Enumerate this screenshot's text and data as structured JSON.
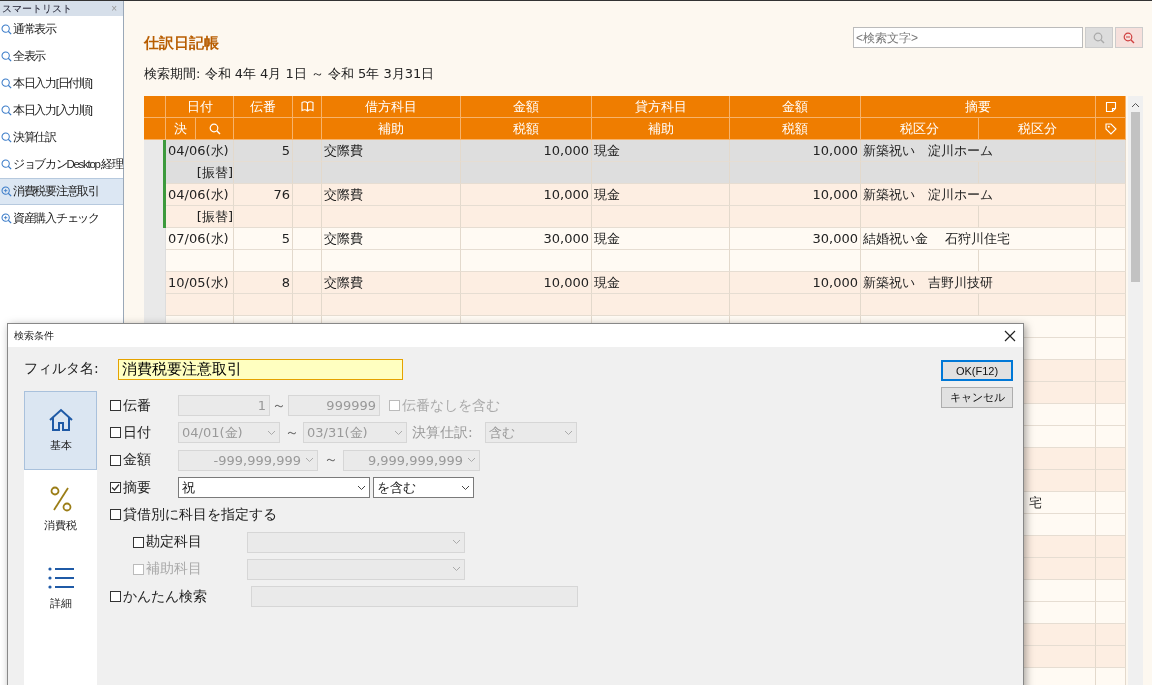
{
  "smart_list": {
    "title": "スマートリスト",
    "close": "×",
    "items": [
      {
        "label": "通常表示",
        "kind": "preset",
        "selected": false
      },
      {
        "label": "全表示",
        "kind": "preset",
        "selected": false
      },
      {
        "label": "本日入力[日付順]",
        "kind": "preset",
        "selected": false
      },
      {
        "label": "本日入力[入力順]",
        "kind": "preset",
        "selected": false
      },
      {
        "label": "決算仕訳",
        "kind": "preset",
        "selected": false
      },
      {
        "label": "ジョブカンDesktop 経理",
        "kind": "preset",
        "selected": false
      },
      {
        "label": "消費税要注意取引",
        "kind": "custom",
        "selected": true
      },
      {
        "label": "資産購入チェック",
        "kind": "custom",
        "selected": false
      }
    ]
  },
  "journal": {
    "title": "仕訳日記帳",
    "period": "検索期間: 令和 4年 4月 1日 ～ 令和 5年 3月31日",
    "search": {
      "placeholder": "<検索文字>"
    },
    "header_top": [
      {
        "kind": "blank"
      },
      {
        "kind": "text",
        "label": "日付"
      },
      {
        "kind": "text",
        "label": "伝番"
      },
      {
        "kind": "book"
      },
      {
        "kind": "text",
        "label": "借方科目"
      },
      {
        "kind": "text",
        "label": "金額"
      },
      {
        "kind": "text",
        "label": "貸方科目"
      },
      {
        "kind": "text",
        "label": "金額"
      },
      {
        "kind": "text",
        "label": "摘要"
      },
      {
        "kind": "note"
      }
    ],
    "header_bottom": [
      {
        "kind": "blank"
      },
      {
        "kind": "text",
        "label": "決"
      },
      {
        "kind": "search"
      },
      {
        "kind": "blank"
      },
      {
        "kind": "blank"
      },
      {
        "kind": "text",
        "label": "補助"
      },
      {
        "kind": "text",
        "label": "税額"
      },
      {
        "kind": "text",
        "label": "補助"
      },
      {
        "kind": "text",
        "label": "税額"
      },
      {
        "kind": "text",
        "label": "税区分"
      },
      {
        "kind": "text",
        "label": "税区分"
      },
      {
        "kind": "tag"
      }
    ],
    "entries": [
      {
        "kind": "entry",
        "selected": true,
        "marked": true,
        "date": "04/06(水)",
        "slip": "5",
        "debit": "交際費",
        "debit_amount": "10,000",
        "credit": "現金",
        "credit_amount": "10,000",
        "summary": "新築祝い　淀川ホーム",
        "note": "[振替]"
      },
      {
        "kind": "entry",
        "selected": false,
        "marked": true,
        "date": "04/06(水)",
        "slip": "76",
        "debit": "交際費",
        "debit_amount": "10,000",
        "credit": "現金",
        "credit_amount": "10,000",
        "summary": "新築祝い　淀川ホーム",
        "note": "[振替]"
      },
      {
        "kind": "entry",
        "selected": false,
        "marked": false,
        "date": "07/06(水)",
        "slip": "5",
        "debit": "交際費",
        "debit_amount": "30,000",
        "credit": "現金",
        "credit_amount": "30,000",
        "summary": "結婚祝い金　 石狩川住宅"
      },
      {
        "kind": "entry",
        "selected": false,
        "marked": false,
        "date": "10/05(水)",
        "slip": "8",
        "debit": "交際費",
        "debit_amount": "10,000",
        "credit": "現金",
        "credit_amount": "10,000",
        "summary": "新築祝い　吉野川技研"
      },
      {
        "kind": "covered"
      },
      {
        "kind": "covered"
      },
      {
        "kind": "covered"
      },
      {
        "kind": "covered"
      },
      {
        "kind": "covered",
        "summary_tail": "宅"
      },
      {
        "kind": "covered"
      },
      {
        "kind": "covered"
      },
      {
        "kind": "covered"
      },
      {
        "kind": "covered"
      }
    ]
  },
  "dialog": {
    "title": "検索条件",
    "filter_label": "フィルタ名:",
    "filter_name": "消費税要注意取引",
    "nav": [
      {
        "label": "基本",
        "kind": "home",
        "selected": true
      },
      {
        "label": "消費税",
        "kind": "percent",
        "selected": false
      },
      {
        "label": "詳細",
        "kind": "list",
        "selected": false
      }
    ],
    "conditions": [
      {
        "kind": "range",
        "label": "伝番",
        "checked": false,
        "from": "1",
        "separator": "～",
        "to": "999999",
        "option": {
          "label": "伝番なしを含む",
          "checked": false
        }
      },
      {
        "kind": "date_range",
        "label": "日付",
        "checked": false,
        "from": "04/01(金)",
        "separator": "～",
        "to": "03/31(金)",
        "option_label": "決算仕訳:",
        "option_value": "含む"
      },
      {
        "kind": "amount_range",
        "label": "金額",
        "checked": false,
        "from": "-999,999,999",
        "separator": "～",
        "to": "9,999,999,999"
      },
      {
        "kind": "text_match",
        "label": "摘要",
        "checked": true,
        "value": "祝",
        "mode": "を含む"
      },
      {
        "kind": "heading",
        "label": "貸借別に科目を指定する",
        "checked": false
      },
      {
        "kind": "account",
        "label": "勘定科目",
        "checked": false,
        "disabled": false
      },
      {
        "kind": "account",
        "label": "補助科目",
        "checked": false,
        "disabled": true
      },
      {
        "kind": "quick",
        "label": "かんたん検索",
        "checked": false
      }
    ],
    "buttons": [
      {
        "label": "OK(F12)",
        "kind": "default"
      },
      {
        "label": "キャンセル",
        "kind": "normal"
      }
    ]
  }
}
